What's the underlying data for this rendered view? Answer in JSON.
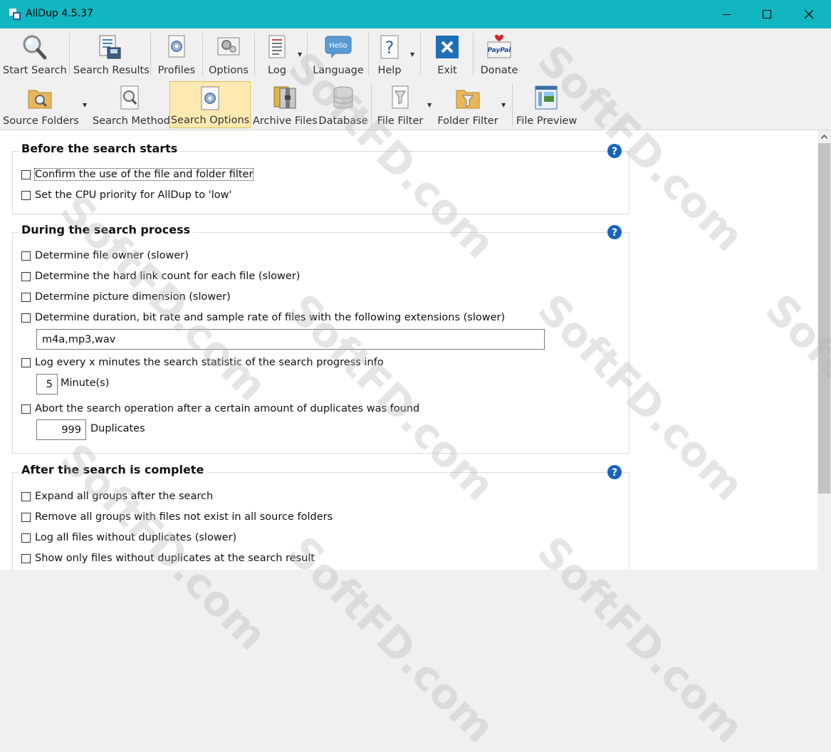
{
  "window": {
    "title": "AllDup 4.5.37",
    "accent_color": "#12b6c0"
  },
  "toolbar_main": {
    "items": [
      {
        "label": "Start Search",
        "icon": "magnifier-icon"
      },
      {
        "label": "Search Results",
        "icon": "search-results-icon"
      },
      {
        "label": "Profiles",
        "icon": "profiles-icon"
      },
      {
        "label": "Options",
        "icon": "options-icon"
      },
      {
        "label": "Log",
        "icon": "log-icon"
      },
      {
        "label": "Language",
        "icon": "hello-bubble-icon",
        "icon_text": "Hello"
      },
      {
        "label": "Help",
        "icon": "help-icon"
      },
      {
        "label": "Exit",
        "icon": "exit-icon"
      },
      {
        "label": "Donate",
        "icon": "paypal-icon",
        "icon_text": "PayPal"
      }
    ]
  },
  "toolbar_search": {
    "items": [
      {
        "label": "Source Folders",
        "icon": "folder-search-icon"
      },
      {
        "label": "Search Method",
        "icon": "search-method-icon"
      },
      {
        "label": "Search Options",
        "icon": "search-options-icon",
        "active": true
      },
      {
        "label": "Archive Files",
        "icon": "archive-icon"
      },
      {
        "label": "Database",
        "icon": "database-icon"
      },
      {
        "label": "File Filter",
        "icon": "file-filter-icon"
      },
      {
        "label": "Folder Filter",
        "icon": "folder-filter-icon"
      },
      {
        "label": "File Preview",
        "icon": "file-preview-icon"
      }
    ]
  },
  "sections": {
    "before": {
      "title": "Before the search starts",
      "options": [
        {
          "label": "Confirm the use of the file and folder filter",
          "checked": false,
          "focused": true
        },
        {
          "label": "Set the CPU priority for AllDup to 'low'",
          "checked": false
        }
      ]
    },
    "during": {
      "title": "During the search process",
      "options": [
        {
          "label": "Determine file owner (slower)",
          "checked": false
        },
        {
          "label": "Determine the hard link count for each file (slower)",
          "checked": false
        },
        {
          "label": "Determine picture dimension (slower)",
          "checked": false
        },
        {
          "label": "Determine duration, bit rate and sample rate of files with the following extensions (slower)",
          "checked": false
        }
      ],
      "extensions_value": "m4a,mp3,wav",
      "log_option": {
        "label": "Log every x minutes the search statistic of the search progress info",
        "checked": false
      },
      "log_minutes": "5",
      "log_unit": "Minute(s)",
      "abort_option": {
        "label": "Abort the search operation after a certain amount of duplicates was found",
        "checked": false
      },
      "abort_count": "999",
      "abort_unit": "Duplicates"
    },
    "after": {
      "title": "After the search is complete",
      "options": [
        {
          "label": "Expand all groups after the search",
          "checked": false
        },
        {
          "label": "Remove all groups with files not exist in all source folders",
          "checked": false
        },
        {
          "label": "Log all files without duplicates (slower)",
          "checked": false
        },
        {
          "label": "Show only files without duplicates at the search result",
          "checked": false
        }
      ]
    }
  },
  "watermark": "SoftFD.com"
}
